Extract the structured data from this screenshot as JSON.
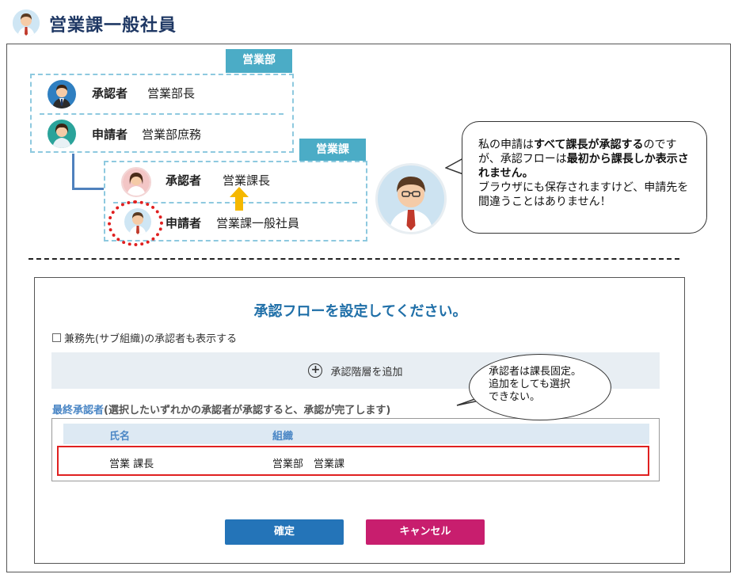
{
  "header": {
    "title": "営業課一般社員"
  },
  "org": {
    "dept_tag": "営業部",
    "dept_rows": [
      {
        "role": "承認者",
        "name": "営業部長"
      },
      {
        "role": "申請者",
        "name": "営業部庶務"
      }
    ],
    "section_tag": "営業課",
    "section_rows": [
      {
        "role": "承認者",
        "name": "営業課長"
      },
      {
        "role": "申請者",
        "name": "営業課一般社員"
      }
    ]
  },
  "speech": {
    "p1": "私の申請は",
    "b1": "すべて課長が承認する",
    "p2": "のですが、承認フローは",
    "b2": "最初から課長しか表示されません。",
    "p3": "ブラウザにも保存されますけど、申請先を間違うことはありません！"
  },
  "dialog": {
    "title": "承認フローを設定してください。",
    "checkbox_label": "兼務先(サブ組織)の承認者も表示する",
    "add_label": "承認階層を追加",
    "final_label_hl": "最終承認者",
    "final_label_rest": "(選択したいずれかの承認者が承認すると、承認が完了します)",
    "table": {
      "headers": [
        "氏名",
        "組織"
      ],
      "rows": [
        {
          "name": "営業 課長",
          "org": "営業部　営業課"
        }
      ]
    },
    "ok_label": "確定",
    "cancel_label": "キャンセル"
  },
  "callout": {
    "line1": "承認者は課長固定。",
    "line2": "追加をしても選択",
    "line3": "できない。"
  },
  "colors": {
    "accent": "#4bacc6",
    "title_blue": "#1f6fa8",
    "ok": "#2474b8",
    "cancel": "#c81e6e",
    "highlight": "#e02020"
  }
}
